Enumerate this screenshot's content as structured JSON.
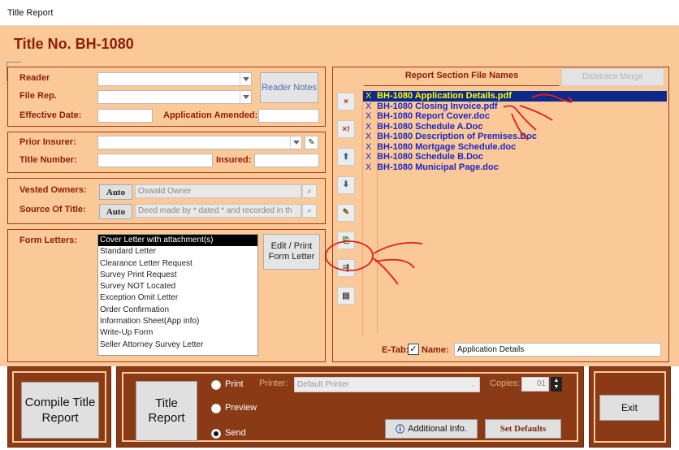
{
  "window": {
    "title": "Title Report"
  },
  "heading": "Title No. BH-1080",
  "fields": {
    "reader_label": "Reader",
    "file_rep_label": "File Rep.",
    "reader_notes_button": "Reader Notes",
    "effective_date_label": "Effective Date:",
    "application_amended_label": "Application Amended:",
    "prior_insurer_label": "Prior Insurer:",
    "title_number_label": "Title Number:",
    "insured_label": "Insured:",
    "vested_owners_label": "Vested Owners:",
    "vested_owners_value": "Oswald Owner",
    "source_of_title_label": "Source Of Title:",
    "source_of_title_value": "Deed made by * dated * and recorded in th",
    "auto_label": "Auto",
    "form_letters_label": "Form Letters:",
    "edit_print_button": "Edit / Print Form Letter"
  },
  "form_letters": [
    "Cover Letter with attachment(s)",
    "Standard Letter",
    "Clearance Letter Request",
    "Survey Print Request",
    "Survey NOT Located",
    "Exception Omit Letter",
    "Order Confirmation",
    "Information Sheet(App info)",
    "Write-Up Form",
    "Seller Attorney Survey Letter"
  ],
  "report_sections": {
    "tab_active": "Report Section File Names",
    "tab_inactive": "Datatrace Merge",
    "files": [
      {
        "mark": "X",
        "name": "BH-1080 Application Details.pdf"
      },
      {
        "mark": "X",
        "name": "BH-1080 Closing Invoice.pdf"
      },
      {
        "mark": "X",
        "name": "BH-1080 Report Cover.doc"
      },
      {
        "mark": "X",
        "name": "BH-1080 Schedule A.Doc"
      },
      {
        "mark": "X",
        "name": "BH-1080 Description of Premises.Doc"
      },
      {
        "mark": "X",
        "name": "BH-1080 Mortgage Schedule.doc"
      },
      {
        "mark": "X",
        "name": "BH-1080 Schedule B.Doc"
      },
      {
        "mark": "X",
        "name": "BH-1080 Municipal Page.doc"
      }
    ],
    "icon_buttons": [
      {
        "icon": "delete-icon",
        "glyph": "×"
      },
      {
        "icon": "delete-all-icon",
        "glyph": "×!"
      },
      {
        "icon": "move-up-icon",
        "glyph": "⬆"
      },
      {
        "icon": "move-down-icon",
        "glyph": "⬇"
      },
      {
        "icon": "edit-icon",
        "glyph": "✎"
      },
      {
        "icon": "add-file-icon",
        "glyph": "⎘"
      },
      {
        "icon": "import-icon",
        "glyph": "⇶"
      },
      {
        "icon": "document-icon",
        "glyph": "▤"
      }
    ],
    "etab_label": "E-Tab:",
    "name_label": "Name:",
    "name_value": "Application Details"
  },
  "bottom": {
    "compile_button": "Compile Title Report",
    "title_report_button": "Title Report",
    "radio_print": "Print",
    "radio_preview": "Preview",
    "radio_send": "Send",
    "selected_output": "Send",
    "printer_label": "Printer:",
    "printer_value": "Default Printer",
    "copies_label": "Copies:",
    "copies_value": "01",
    "additional_info_button": "Additional Info.",
    "set_defaults_button": "Set Defaults",
    "exit_button": "Exit"
  },
  "colors": {
    "background": "#fbc898",
    "accent": "#8b1e0b",
    "bottom_panel": "#8b3a16",
    "file_text": "#1a27c9",
    "selection": "#0b2a8c",
    "annotation": "#e0201c"
  }
}
